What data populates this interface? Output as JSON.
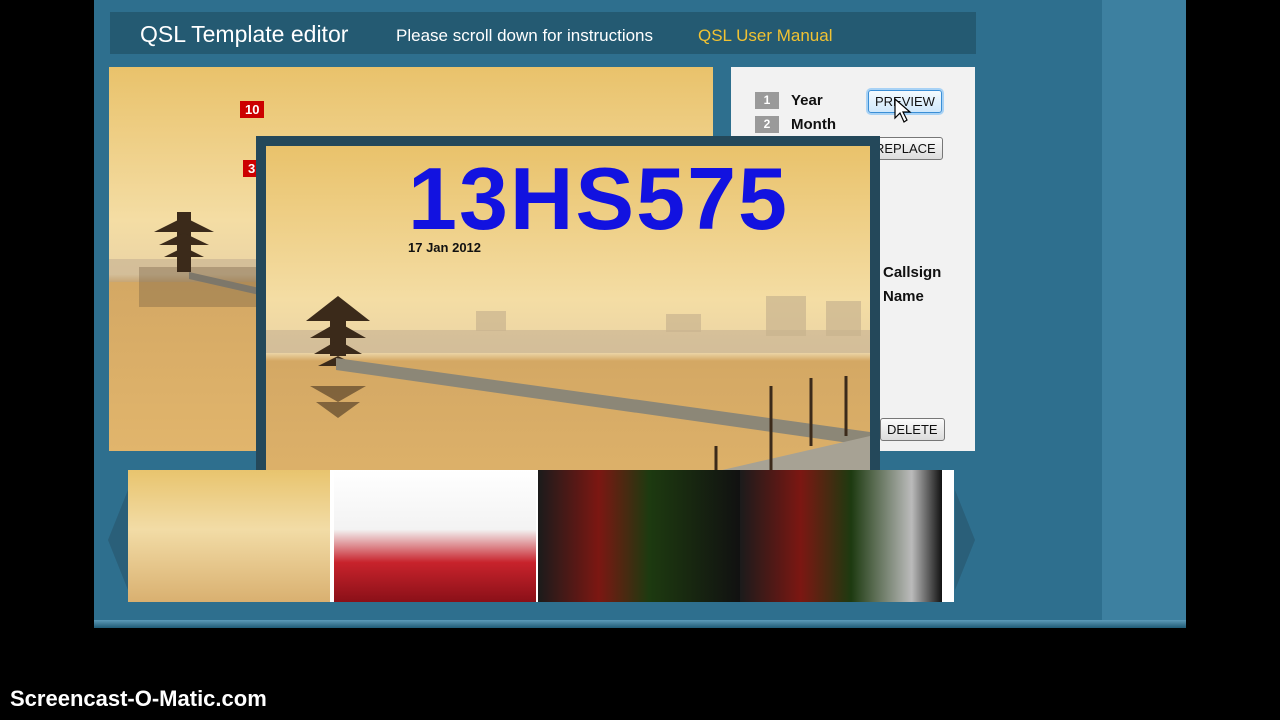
{
  "header": {
    "title": "QSL Template editor",
    "hint": "Please scroll down for instructions",
    "manual_link": "QSL User Manual"
  },
  "canvas": {
    "markers": [
      "10",
      "3"
    ]
  },
  "side_panel": {
    "fields": [
      {
        "num": "1",
        "label": "Year"
      },
      {
        "num": "2",
        "label": "Month"
      }
    ],
    "labels": [
      "Callsign",
      "Name"
    ],
    "buttons": {
      "preview": "PREVIEW",
      "replace": "REPLACE",
      "delete": "DELETE"
    }
  },
  "preview": {
    "callsign": "13HS575",
    "date": "17  Jan 2012"
  },
  "thumbnails": {
    "count": 4
  },
  "watermark": "Screencast-O-Matic.com",
  "colors": {
    "page_bg": "#2e6f8e",
    "header_bg": "#245a72",
    "link": "#f1c232",
    "callsign": "#1212e0",
    "marker": "#cc0000"
  }
}
